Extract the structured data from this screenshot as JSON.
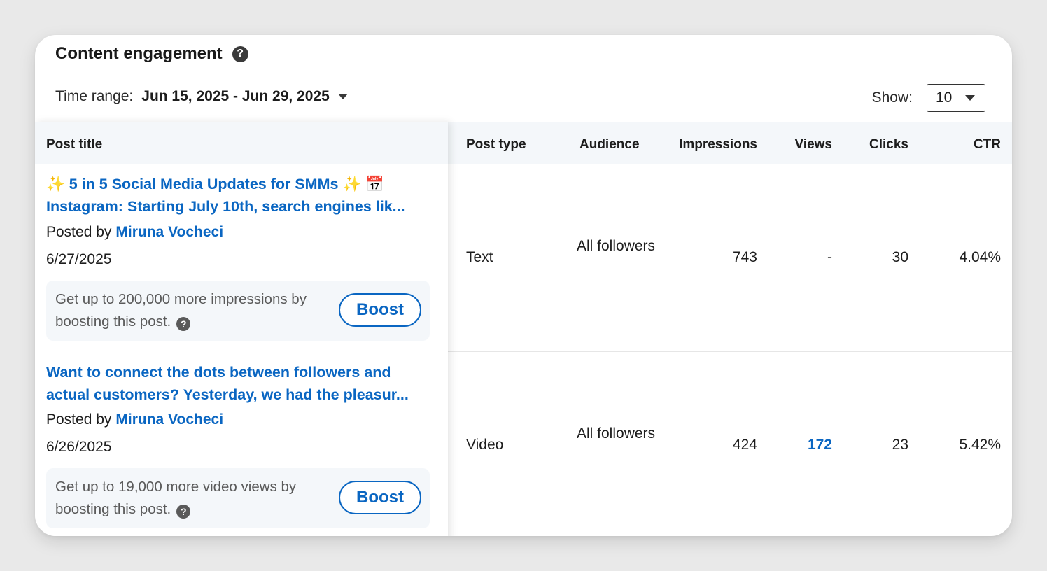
{
  "header": {
    "title": "Content engagement",
    "help_icon": "question-circle-icon",
    "time_range_label": "Time range:",
    "time_range_value": "Jun 15, 2025 - Jun 29, 2025",
    "show_label": "Show:",
    "show_value": "10"
  },
  "table": {
    "columns": {
      "post_title": "Post title",
      "post_type": "Post type",
      "audience": "Audience",
      "impressions": "Impressions",
      "views": "Views",
      "clicks": "Clicks",
      "ctr": "CTR"
    },
    "rows": [
      {
        "title_line1_prefix": "✨",
        "title_line1_text": " 5 in 5 Social Media Updates for SMMs ",
        "title_line1_suffix": "✨",
        "title_line1_emoji": "📅",
        "title_line2": "Instagram: Starting July 10th, search engines lik...",
        "posted_by_label": "Posted by",
        "author": "Miruna Vocheci",
        "date": "6/27/2025",
        "boost_text": "Get up to 200,000 more impressions by boosting this post.",
        "boost_button": "Boost",
        "post_type": "Text",
        "audience": "All followers",
        "impressions": "743",
        "views": "-",
        "clicks": "30",
        "ctr": "4.04%"
      },
      {
        "title_line1": "Want to connect the dots between followers and",
        "title_line2": "actual customers? Yesterday, we had the pleasur...",
        "posted_by_label": "Posted by",
        "author": "Miruna Vocheci",
        "date": "6/26/2025",
        "boost_text": "Get up to 19,000 more video views by boosting this post.",
        "boost_button": "Boost",
        "post_type": "Video",
        "audience": "All followers",
        "impressions": "424",
        "views": "172",
        "clicks": "23",
        "ctr": "5.42%"
      }
    ]
  },
  "colors": {
    "link_blue": "#0a66c2",
    "header_bg": "#f4f7fa",
    "page_bg": "#e9e9e9"
  }
}
